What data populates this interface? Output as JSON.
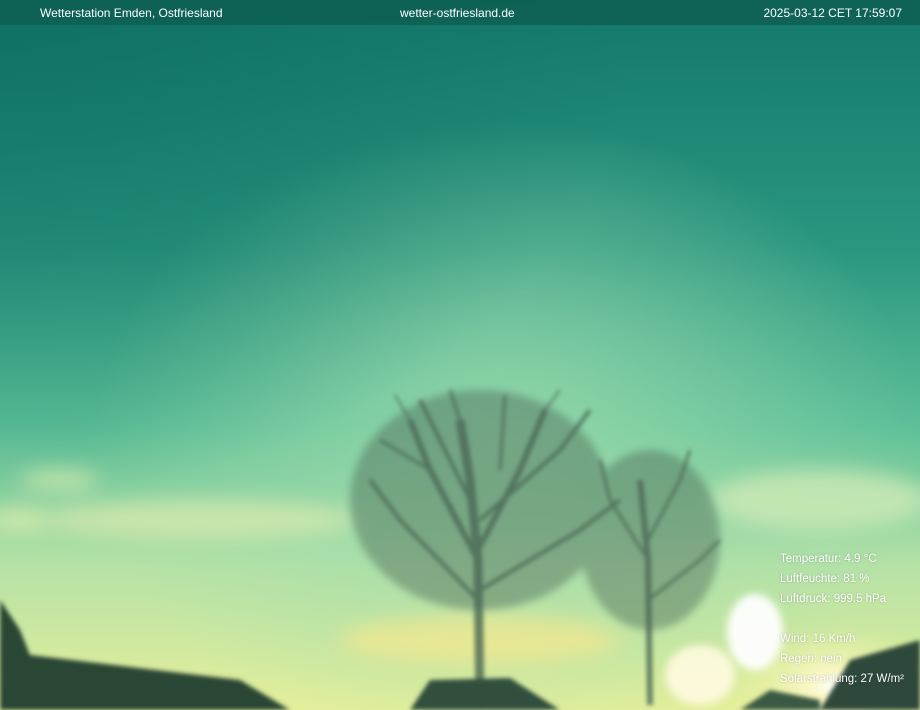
{
  "header": {
    "station": "Wetterstation Emden, Ostfriesland",
    "website": "wetter-ostfriesland.de",
    "timestamp": "2025-03-12 CET 17:59:07"
  },
  "readings": {
    "temperature": "Temperatur: 4.9 °C",
    "humidity": "Luftfeuchte: 81 %",
    "pressure": "Luftdruck: 999.5 hPa",
    "wind": "Wind: 16 Km/h",
    "rain": "Regen: nein",
    "solar": "Solarstrahlung: 27 W/m²"
  },
  "colors": {
    "sky_top": "#15786a",
    "sky_mid": "#52b89a",
    "sky_glow": "#a8e0b0",
    "horizon": "#e8f0a0",
    "sun": "#fffbe0",
    "silhouette": "#2c4a3a"
  }
}
